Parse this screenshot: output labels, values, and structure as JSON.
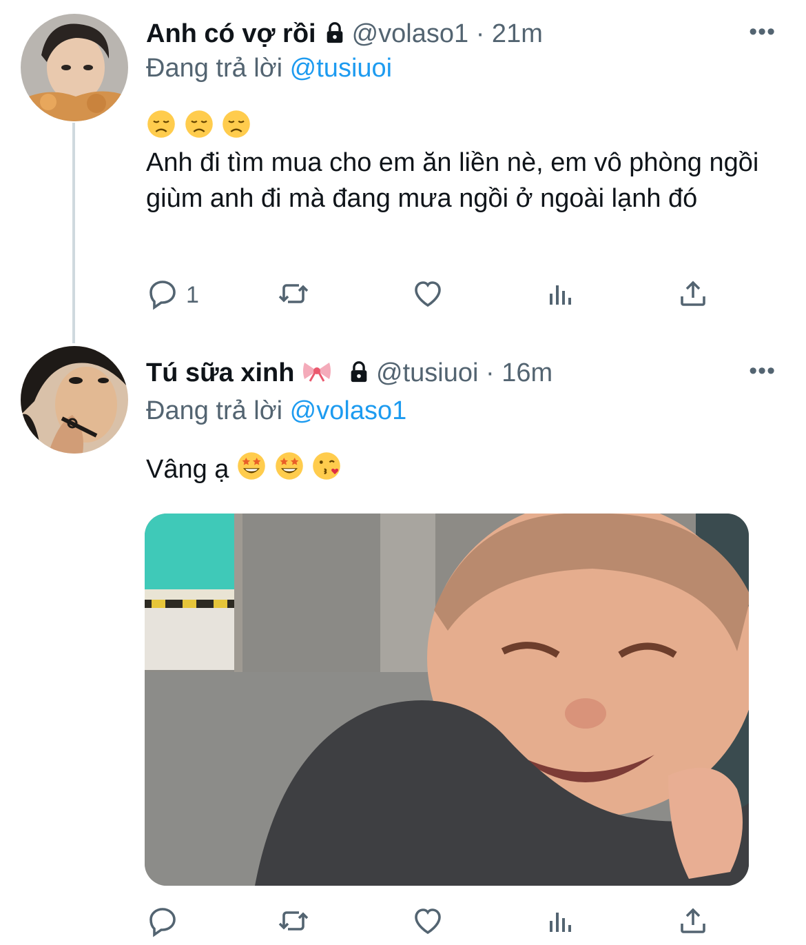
{
  "tweets": [
    {
      "name": "Anh có vợ rồi",
      "handle": "@volaso1",
      "time": "· 21m",
      "replying_prefix": "Đang trả lời",
      "replying_to": "@tusiuoi",
      "text": "Anh đi tìm mua cho em ăn liền nè, em vô phòng ngồi giùm anh đi mà đang mưa ngồi ở ngoài lạnh đó",
      "emojis": [
        "disappointed-face",
        "disappointed-face",
        "disappointed-face"
      ],
      "reply_count": "1",
      "more": "•••"
    },
    {
      "name": "Tú sữa xinh",
      "name_emoji": "ribbon",
      "handle": "@tusiuoi",
      "time": "· 16m",
      "replying_prefix": "Đang trả lời",
      "replying_to": "@volaso1",
      "text": "Vâng ạ",
      "emojis": [
        "star-struck-face",
        "star-struck-face",
        "face-blowing-kiss"
      ],
      "more": "•••",
      "media": "laughing-baby-photo"
    }
  ],
  "icons": [
    "reply-icon",
    "retweet-icon",
    "like-icon",
    "analytics-icon",
    "share-icon",
    "lock-icon",
    "more-icon"
  ],
  "colors": {
    "link": "#1d9bf0",
    "secondary": "#536471",
    "thread_line": "#cfd9de"
  }
}
